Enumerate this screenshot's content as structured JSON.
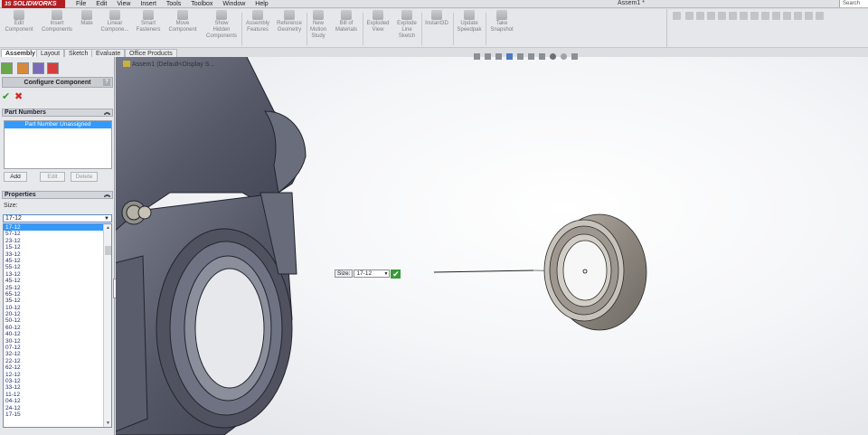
{
  "app": {
    "logo": "SOLIDWORKS",
    "logo_prefix": "3S",
    "document_title": "Assem1 *",
    "search_placeholder": "Search"
  },
  "menu": [
    "File",
    "Edit",
    "View",
    "Insert",
    "Tools",
    "Toolbox",
    "Window",
    "Help"
  ],
  "command_manager": [
    {
      "id": "edit-component",
      "label": "Edit\nComponent"
    },
    {
      "id": "insert-components",
      "label": "Insert\nComponents"
    },
    {
      "id": "mate",
      "label": "Mate"
    },
    {
      "id": "linear-component",
      "label": "Linear\nCompone..."
    },
    {
      "id": "smart-fasteners",
      "label": "Smart\nFasteners"
    },
    {
      "id": "move-component",
      "label": "Move\nComponent"
    },
    {
      "id": "show-hidden-components",
      "label": "Show\nHidden\nComponents"
    },
    {
      "id": "assembly-features",
      "label": "Assembly\nFeatures"
    },
    {
      "id": "reference-geometry",
      "label": "Reference\nGeometry"
    },
    {
      "id": "new-motion-study",
      "label": "New\nMotion\nStudy"
    },
    {
      "id": "bill-of-materials",
      "label": "Bill of\nMaterials"
    },
    {
      "id": "exploded-view",
      "label": "Exploded\nView"
    },
    {
      "id": "explode-line-sketch",
      "label": "Explode\nLine\nSketch"
    },
    {
      "id": "instant3d",
      "label": "Instant3D"
    },
    {
      "id": "update-speedpak",
      "label": "Update\nSpeedpak"
    },
    {
      "id": "take-snapshot",
      "label": "Take\nSnapshot"
    }
  ],
  "tabs": [
    "Assembly",
    "Layout",
    "Sketch",
    "Evaluate",
    "Office Products"
  ],
  "active_tab": "Assembly",
  "property_manager": {
    "title": "Configure Component",
    "help": "?",
    "ok": "✔",
    "cancel": "✖",
    "part_numbers": {
      "heading": "Part Numbers",
      "items": [
        "Part Number Unassigned"
      ],
      "add": "Add",
      "edit": "Edit",
      "delete": "Delete"
    },
    "properties": {
      "heading": "Properties",
      "size_label": "Size:",
      "size_value": "17-12",
      "size_options": [
        "17-12",
        "57-12",
        "23-12",
        "15-12",
        "33-12",
        "45-12",
        "55-12",
        "13-12",
        "45-12",
        "25-12",
        "65-12",
        "35-12",
        "10-12",
        "20-12",
        "50-12",
        "60-12",
        "40-12",
        "30-12",
        "07-12",
        "32-12",
        "22-12",
        "62-12",
        "12-12",
        "03-12",
        "33-12",
        "11-12",
        "04-12",
        "24-12",
        "17-15"
      ]
    }
  },
  "viewport": {
    "tree_root": "Assem1 (Default<Display S...",
    "callout_label": "Size:",
    "callout_value": "17-12",
    "callout_ok": "✔"
  }
}
